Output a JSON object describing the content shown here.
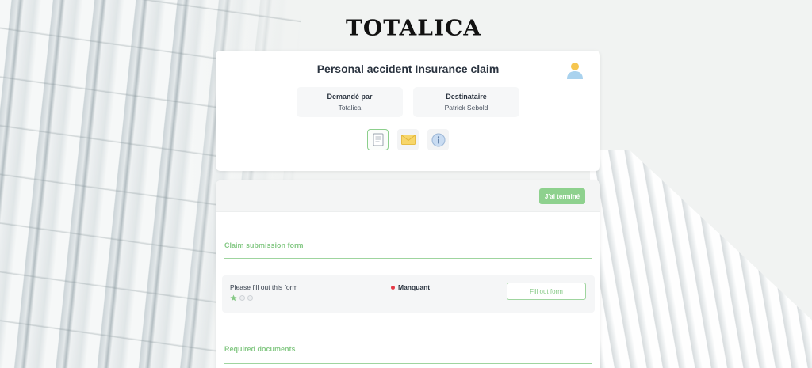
{
  "brand": {
    "logo_text": "TOTALICA"
  },
  "claim": {
    "title": "Personal accident Insurance claim",
    "requested_by_label": "Demandé par",
    "requested_by_value": "Totalica",
    "recipient_label": "Destinataire",
    "recipient_value": "Patrick Sebold"
  },
  "tabs": [
    {
      "icon": "document-icon",
      "active": true
    },
    {
      "icon": "envelope-icon",
      "active": false
    },
    {
      "icon": "info-icon",
      "active": false
    }
  ],
  "main": {
    "done_button": "J'ai terminé",
    "sections": {
      "claim_form_title": "Claim submission form",
      "required_docs_title": "Required documents"
    },
    "form_row": {
      "text": "Please fill out this form",
      "status": "Manquant",
      "status_color": "#e53945",
      "button": "Fill out form",
      "stars_filled": 1,
      "stars_total": 3
    }
  },
  "colors": {
    "accent_green": "#8ed18e",
    "title_dark": "#2b3440"
  }
}
